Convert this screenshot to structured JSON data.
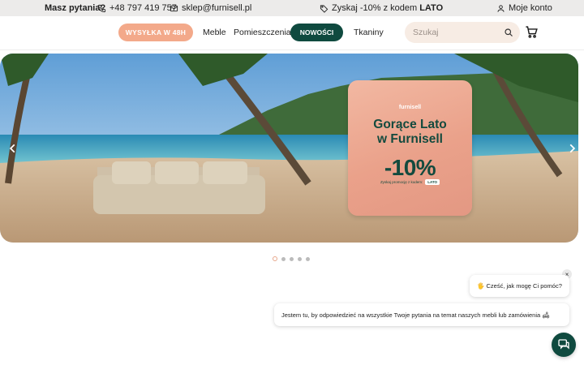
{
  "topbar": {
    "question": "Masz pytania?",
    "phone": "+48 797 419 757",
    "email": "sklep@furnisell.pl",
    "promo_prefix": "Zyskaj -10% z kodem ",
    "promo_code": "LATO",
    "account": "Moje konto"
  },
  "nav": {
    "shipping": "WYSYŁKA W 48H",
    "meble": "Meble",
    "pomieszczenia": "Pomieszczenia",
    "nowosci": "NOWOŚCI",
    "tkaniny": "Tkaniny"
  },
  "search": {
    "placeholder": "Szukaj"
  },
  "hero": {
    "brand": "furnisell",
    "title_line1": "Gorące Lato",
    "title_line2": "w Furnisell",
    "discount": "-10%",
    "code_text": "Zyskaj promocję z kodem:",
    "code": "LATO"
  },
  "carousel": {
    "slides": 5,
    "active": 1
  },
  "chat": {
    "greeting": "🖐 Cześć, jak mogę Ci pomóc?",
    "message": "Jestem tu, by odpowiedzieć na wszystkie Twoje pytania na temat naszych mebli lub zamówienia 🛋",
    "close": "×"
  },
  "colors": {
    "accent_peach": "#f3a98a",
    "accent_green": "#0f4a3f",
    "topbar_bg": "#ecebea"
  }
}
